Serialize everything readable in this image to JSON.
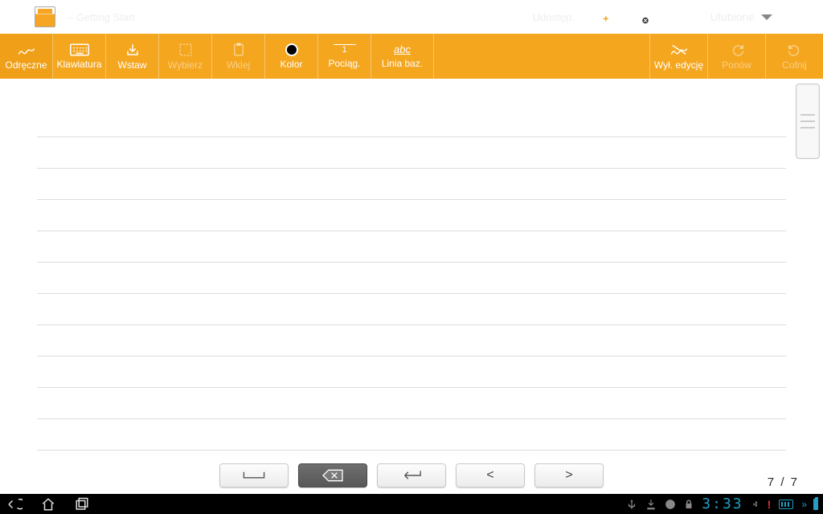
{
  "titlebar": {
    "doc_title": "-- Getting Start",
    "share_label": "Udostęp.",
    "favorites_label": "Ulubione"
  },
  "toolbar": {
    "freehand": "Odręczne",
    "keyboard": "Klawiatura",
    "insert": "Wstaw",
    "select": "Wybierz",
    "paste": "Wklej",
    "color": "Kolor",
    "stroke": "Pociąg.",
    "stroke_value": "1",
    "baseline": "Linia baz.",
    "baseline_sample": "abc",
    "toggle_edit": "Wył. edycję",
    "redo": "Ponów",
    "undo": "Cofnij"
  },
  "page": {
    "current": "7",
    "total": "7",
    "sep": "/"
  },
  "status": {
    "time": "3:33"
  }
}
